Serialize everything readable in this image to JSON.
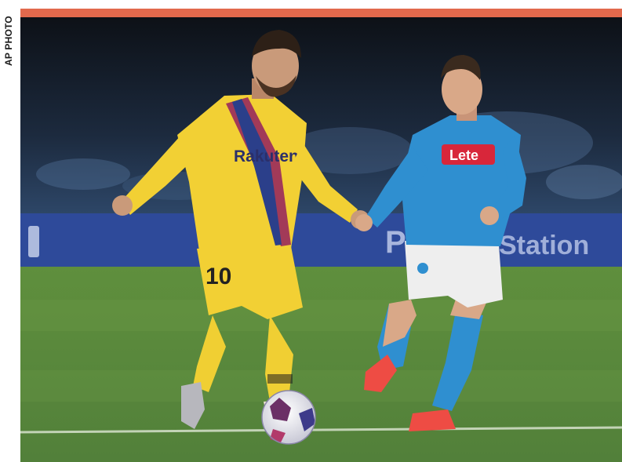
{
  "photo_credit": "AP PHOTO",
  "colors": {
    "accent_bar": "#e2694d",
    "stadium_dark": "#12161c",
    "hoarding": "#2e4a9a",
    "pitch": "#5f8a3c",
    "barca_kit": "#f2d034",
    "napoli_kit": "#2f8fd0"
  },
  "jersey": {
    "left_sponsor": "Rakuten",
    "left_number": "10",
    "right_sponsor": "Lete"
  }
}
